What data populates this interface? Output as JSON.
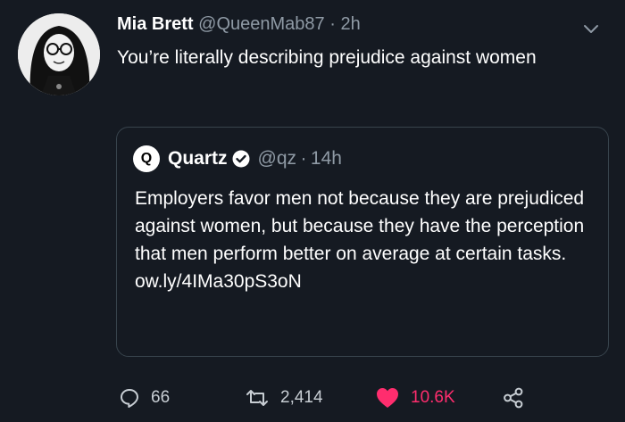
{
  "tweet": {
    "name": "Mia Brett",
    "handle": "@QueenMab87",
    "separator": "·",
    "time": "2h",
    "text": "You’re literally describing prejudice against women"
  },
  "quoted": {
    "logo_letter": "Q",
    "name": "Quartz",
    "handle": "@qz",
    "separator": "·",
    "time": "14h",
    "text": "Employers favor men not because they are prejudiced against women, but because they have the perception that men perform better on average at certain tasks. ow.ly/4IMa30pS3oN"
  },
  "actions": {
    "reply_count": "66",
    "retweet_count": "2,414",
    "like_count": "10.6K"
  },
  "icons": {
    "reply": "reply-icon",
    "retweet": "retweet-icon",
    "like": "heart-icon",
    "share": "share-icon",
    "menu": "chevron-down-icon",
    "verified": "verified-badge-icon"
  },
  "colors": {
    "background": "#151a22",
    "like": "#ff2d6e",
    "muted": "#8f9aa5",
    "border": "#38444d"
  }
}
